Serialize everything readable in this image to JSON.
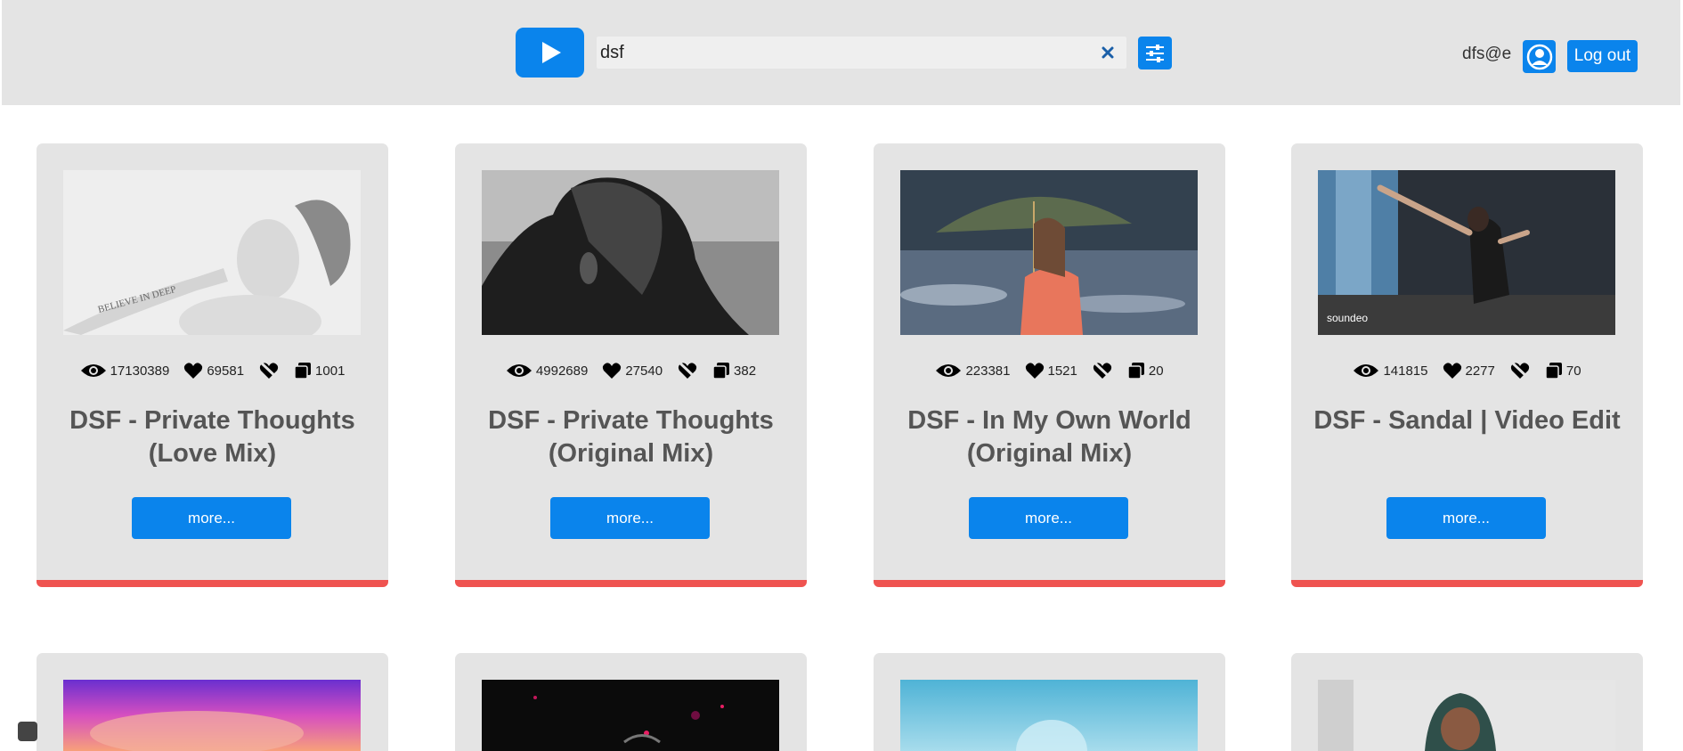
{
  "header": {
    "search_value": "dsf",
    "user_email": "dfs@e",
    "logout_label": "Log out"
  },
  "cards": [
    {
      "views": "17130389",
      "likes": "69581",
      "copies": "1001",
      "title": "DSF - Private Thoughts (Love Mix)",
      "more_label": "more..."
    },
    {
      "views": "4992689",
      "likes": "27540",
      "copies": "382",
      "title": "DSF - Private Thoughts (Original Mix)",
      "more_label": "more..."
    },
    {
      "views": "223381",
      "likes": "1521",
      "copies": "20",
      "title": "DSF - In My Own World (Original Mix)",
      "more_label": "more..."
    },
    {
      "views": "141815",
      "likes": "2277",
      "copies": "70",
      "title": "DSF - Sandal | Video Edit",
      "more_label": "more...",
      "thumb_watermark": "soundeo"
    }
  ],
  "colors": {
    "accent": "#0a84ec",
    "card_bg": "#e4e4e4",
    "card_bottom_bar": "#ef5350"
  }
}
